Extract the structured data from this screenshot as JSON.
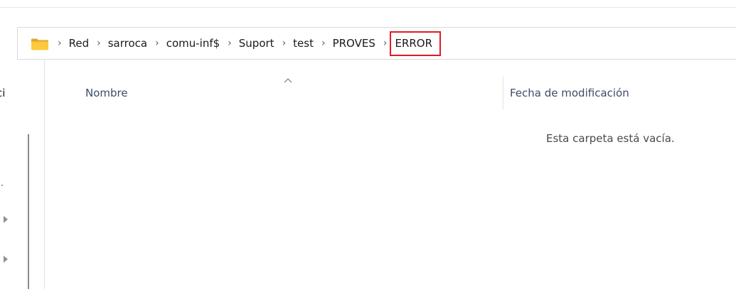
{
  "address_bar": {
    "folder_icon": "folder-icon",
    "crumbs": [
      "Red",
      "sarroca",
      "comu-inf$",
      "Suport",
      "test",
      "PROVES",
      "ERROR"
    ],
    "separator_icon": "chevron-right-icon",
    "highlight_color": "#e01b24"
  },
  "nav_pane": {
    "partial_label": "ci"
  },
  "columns": {
    "name_header": "Nombre",
    "date_header": "Fecha de modificación",
    "sort_icon": "sort-ascending-icon"
  },
  "content": {
    "empty_message": "Esta carpeta está vacía."
  }
}
